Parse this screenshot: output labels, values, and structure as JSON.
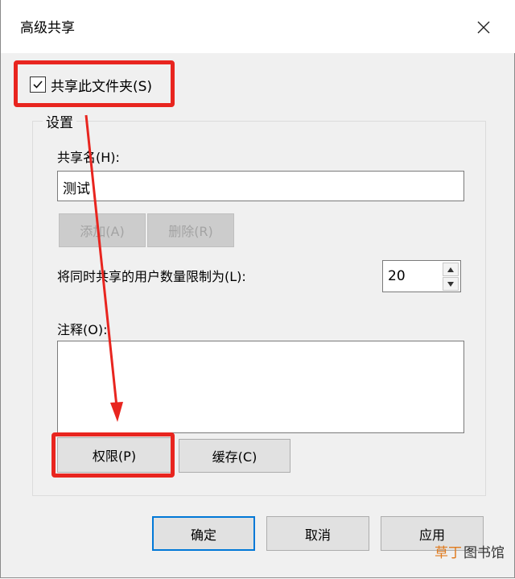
{
  "window": {
    "title": "高级共享",
    "close_icon": "close-icon"
  },
  "share_checkbox": {
    "label": "共享此文件夹(S)",
    "checked": true
  },
  "settings": {
    "legend": "设置",
    "share_name_label": "共享名(H):",
    "share_name_value": "测试",
    "add_button": "添加(A)",
    "remove_button": "删除(R)",
    "user_limit_label": "将同时共享的用户数量限制为(L):",
    "user_limit_value": "20",
    "comment_label": "注释(O):",
    "comment_value": "",
    "permissions_button": "权限(P)",
    "cache_button": "缓存(C)"
  },
  "footer": {
    "ok_button": "确定",
    "cancel_button": "取消",
    "apply_button": "应用"
  },
  "annotations": {
    "highlight_color": "#e8251f",
    "accent_color": "#0078d7"
  },
  "watermark": {
    "text_part1": "草丁",
    "text_part2": "图书馆"
  }
}
